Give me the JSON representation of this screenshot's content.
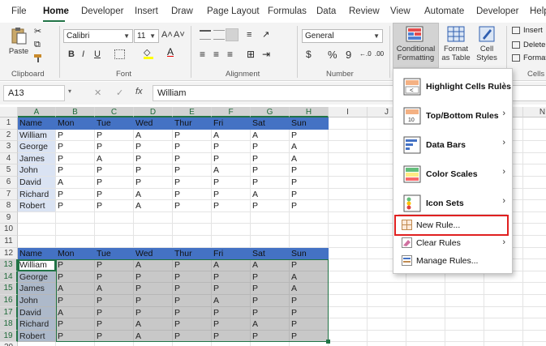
{
  "menu_tabs": [
    "File",
    "Home",
    "Developer",
    "Insert",
    "Draw",
    "Page Layout",
    "Formulas",
    "Data",
    "Review",
    "View",
    "Automate",
    "Developer",
    "Help"
  ],
  "ribbon": {
    "clipboard": {
      "paste_label": "Paste",
      "group_label": "Clipboard"
    },
    "font": {
      "font_name": "Calibri",
      "font_size": "11",
      "grow": "A˄",
      "shrink": "A˅",
      "bold": "B",
      "italic": "I",
      "underline": "U",
      "group_label": "Font"
    },
    "alignment": {
      "group_label": "Alignment"
    },
    "number": {
      "format": "General",
      "currency": "$",
      "percent": "%",
      "comma": "9",
      "group_label": "Number"
    },
    "styles": {
      "conditional_formatting": "Conditional Formatting",
      "format_as_table": "Format as Table",
      "cell_styles": "Cell Styles"
    },
    "cells": {
      "insert": "Insert",
      "delete": "Delete",
      "format": "Format",
      "group_label": "Cells"
    }
  },
  "formula_bar": {
    "name_box": "A13",
    "fx": "fx",
    "cancel": "✕",
    "enter": "✓",
    "value": "William"
  },
  "columns": [
    "A",
    "B",
    "C",
    "D",
    "E",
    "F",
    "G",
    "H",
    "I",
    "J",
    "K",
    "L",
    "M",
    "N"
  ],
  "rows": [
    "1",
    "2",
    "3",
    "4",
    "5",
    "6",
    "7",
    "8",
    "9",
    "10",
    "11",
    "12",
    "13",
    "14",
    "15",
    "16",
    "17",
    "18",
    "19",
    "20"
  ],
  "table1": {
    "header": [
      "Name",
      "Mon",
      "Tue",
      "Wed",
      "Thur",
      "Fri",
      "Sat",
      "Sun"
    ],
    "rows": [
      [
        "William",
        "P",
        "P",
        "A",
        "P",
        "A",
        "A",
        "P"
      ],
      [
        "George",
        "P",
        "P",
        "P",
        "P",
        "P",
        "P",
        "A"
      ],
      [
        "James",
        "P",
        "A",
        "P",
        "P",
        "P",
        "P",
        "A"
      ],
      [
        "John",
        "P",
        "P",
        "P",
        "P",
        "A",
        "P",
        "P"
      ],
      [
        "David",
        "A",
        "P",
        "P",
        "P",
        "P",
        "P",
        "P"
      ],
      [
        "Richard",
        "P",
        "P",
        "A",
        "P",
        "P",
        "A",
        "P"
      ],
      [
        "Robert",
        "P",
        "P",
        "A",
        "P",
        "P",
        "P",
        "P"
      ]
    ]
  },
  "table2": {
    "header": [
      "Name",
      "Mon",
      "Tue",
      "Wed",
      "Thur",
      "Fri",
      "Sat",
      "Sun"
    ],
    "rows": [
      [
        "William",
        "P",
        "P",
        "A",
        "P",
        "A",
        "A",
        "P"
      ],
      [
        "George",
        "P",
        "P",
        "P",
        "P",
        "P",
        "P",
        "A"
      ],
      [
        "James",
        "A",
        "A",
        "P",
        "P",
        "P",
        "P",
        "A"
      ],
      [
        "John",
        "P",
        "P",
        "P",
        "P",
        "A",
        "P",
        "P"
      ],
      [
        "David",
        "A",
        "P",
        "P",
        "P",
        "P",
        "P",
        "P"
      ],
      [
        "Richard",
        "P",
        "P",
        "A",
        "P",
        "P",
        "A",
        "P"
      ],
      [
        "Robert",
        "P",
        "P",
        "A",
        "P",
        "P",
        "P",
        "P"
      ]
    ]
  },
  "dropdown": {
    "items": [
      {
        "label": "Highlight Cells Rules",
        "submenu": true,
        "icon": "highlight-cells-icon"
      },
      {
        "label": "Top/Bottom Rules",
        "submenu": true,
        "icon": "top-bottom-icon"
      },
      {
        "label": "Data Bars",
        "submenu": true,
        "icon": "data-bars-icon"
      },
      {
        "label": "Color Scales",
        "submenu": true,
        "icon": "color-scales-icon"
      },
      {
        "label": "Icon Sets",
        "submenu": true,
        "icon": "icon-sets-icon"
      },
      {
        "label": "New Rule...",
        "submenu": false,
        "icon": "new-rule-icon"
      },
      {
        "label": "Clear Rules",
        "submenu": true,
        "icon": "clear-rules-icon"
      },
      {
        "label": "Manage Rules...",
        "submenu": false,
        "icon": "manage-rules-icon"
      }
    ],
    "highlight_color": "#e02020"
  },
  "colors": {
    "accent": "#217346",
    "header_blue": "#4472c4",
    "name_tint": "#dae3f3",
    "grey_fill": "#c8c8c8"
  }
}
